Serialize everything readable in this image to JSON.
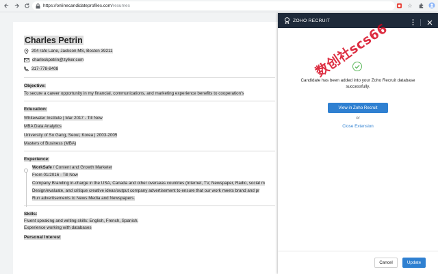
{
  "browser": {
    "url_domain": "https://onlinecandidateprofiles.com",
    "url_path": "/resumes",
    "nav_icons": [
      "back-arrow-icon",
      "forward-arrow-icon",
      "reload-icon"
    ],
    "extension_icons": [
      "zoho-recruit-extension-icon",
      "star-icon",
      "puzzle-icon",
      "profile-icon"
    ]
  },
  "resume": {
    "name": "Charles Petrin",
    "address": "204 rafe Lane, Jackson MS, Boston 39211",
    "email": "charleskpetrin@zylker.com",
    "phone": "317-778-8408",
    "objective_title": "Objective:",
    "objective_text": "To secure a career opportunity in my financial, communications, and marketing experience benefits to cooperation's",
    "education_title": "Education:",
    "edu1_line": "Whitewater Institute  |  Mar 2017 - Till Now",
    "edu1_degree": "MBA Data Analytics",
    "edu2_line": "University of So Gang, Seoul, Korea  |  2003-2005",
    "edu2_degree": "Masters of Business (MBA)",
    "experience_title": "Experience:",
    "exp_company": "WorkSafe",
    "exp_role": "Content and Growth Marketer",
    "exp_dates": "From 01/2016 - Till Now",
    "exp_desc1": "Company Branding in-charge in the USA, Canada and other overseas countries (Internet, TV, Newspaper, Radio, social m",
    "exp_desc2": "Design/evaluate, and critique creative ideas/output company advertisement to ensure that our work meets brand and pr",
    "exp_desc3": "Run advertisements to News Media and Newspapers.",
    "skills_title": "Skills:",
    "skills_line1": "Fluent speaking and writing skills: English, French, Spanish.",
    "skills_line2": "Experience working with databases",
    "personal_title": "Personal Interest"
  },
  "panel": {
    "title": "ZOHO RECRUIT",
    "message": "Candidate has been added into your Zoho Recruit database successfully.",
    "view_button": "View in Zoho Recruit",
    "or_text": "or",
    "close_link": "Close Extension",
    "cancel_button": "Cancel",
    "update_button": "Update"
  },
  "watermark": "数创社scs66",
  "colors": {
    "panel_header": "#1e2a3a",
    "accent_blue": "#2f80d1",
    "success_green": "#5cb85c",
    "watermark_red": "#d60018"
  }
}
